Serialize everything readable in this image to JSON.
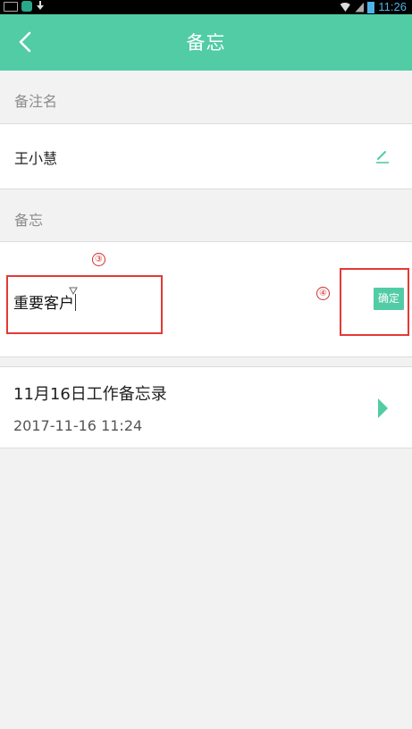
{
  "status_bar": {
    "time": "11:26",
    "icons": [
      "keyboard-icon",
      "app-notification-icon",
      "download-icon",
      "wifi-icon",
      "signal-icon",
      "battery-icon"
    ]
  },
  "header": {
    "title": "备忘",
    "back_icon": "chevron-left-icon"
  },
  "remark_name": {
    "section_label": "备注名",
    "value": "王小慧",
    "edit_icon": "pencil-icon"
  },
  "memo": {
    "section_label": "备忘",
    "input_value": "重要客户",
    "confirm_label": "确定"
  },
  "annotations": {
    "input_marker": "③",
    "confirm_marker": "④",
    "color": "#e53935"
  },
  "record": {
    "title": "11月16日工作备忘录",
    "date": "2017-11-16 11:24",
    "arrow_icon": "play-arrow-icon"
  },
  "colors": {
    "accent": "#52cca5",
    "background": "#f2f2f2"
  }
}
